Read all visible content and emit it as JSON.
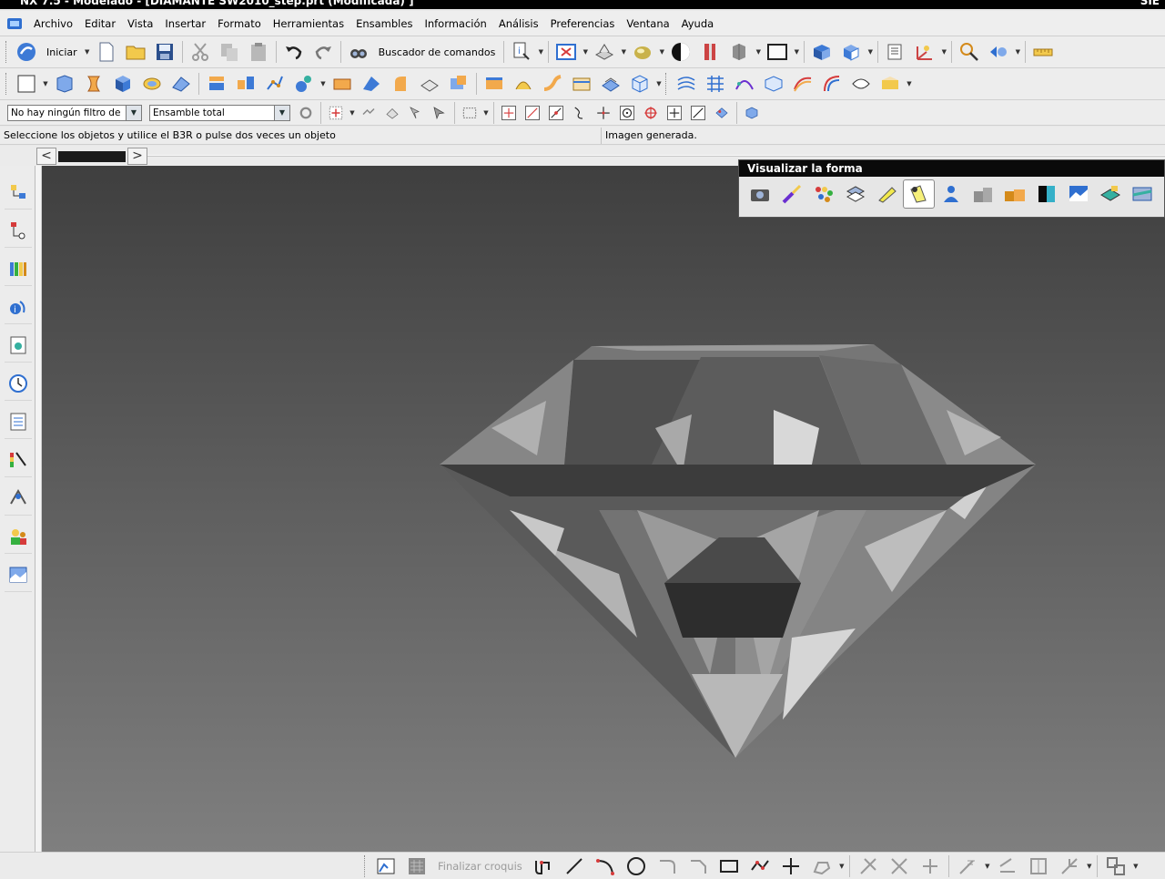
{
  "window": {
    "title": "NX 7.5 - Modelado - [DIAMANTE SW2010_step.prt (Modificada) ]",
    "brand": "SIE"
  },
  "menu": [
    "Archivo",
    "Editar",
    "Vista",
    "Insertar",
    "Formato",
    "Herramientas",
    "Ensambles",
    "Información",
    "Análisis",
    "Preferencias",
    "Ventana",
    "Ayuda"
  ],
  "toolbar1": {
    "start_label": "Iniciar",
    "command_finder_label": "Buscador de comandos"
  },
  "selection_bar": {
    "filter_value": "No hay ningún filtro de",
    "scope_value": "Ensamble total"
  },
  "status": {
    "prompt": "Seleccione los objetos y utilice el B3R o pulse dos veces un objeto",
    "message": "Imagen generada."
  },
  "shape_palette": {
    "title": "Visualizar la forma"
  },
  "sketch_bar": {
    "finish_label": "Finalizar croquis"
  },
  "colors": {
    "accent": "#2f6fd0",
    "viewport_top": "#3f3f3f",
    "viewport_bottom": "#7f7f7f",
    "titlebar": "#000000"
  },
  "icons": {
    "toolbar1": [
      "start-icon",
      "new-file-icon",
      "open-folder-icon",
      "save-icon",
      "cut-icon",
      "copy-icon",
      "paste-icon",
      "undo-icon",
      "redo-icon",
      "command-finder-icon",
      "info-icon",
      "fit-icon",
      "orient-view-icon",
      "shading-icon",
      "render-style-icon",
      "section-icon",
      "box-icon",
      "frame-icon",
      "assembly-icon",
      "component-icon",
      "layers-icon",
      "wcs-icon",
      "analysis-icon",
      "motion-icon",
      "measure-icon"
    ],
    "toolbar2": [
      "sketch-icon",
      "extrude-icon",
      "revolve-icon",
      "block-icon",
      "surface-icon",
      "shell-icon",
      "datum-icon",
      "pattern-icon",
      "point-icon",
      "edge-blend-icon",
      "chamfer-icon",
      "draft-icon",
      "trim-icon",
      "mirror-icon",
      "unite-icon"
    ],
    "resource_bar": [
      "assembly-navigator-icon",
      "constraint-navigator-icon",
      "part-navigator-icon",
      "reuse-library-icon",
      "history-icon",
      "web-browser-icon",
      "clock-icon",
      "roles-icon",
      "analysis-icon",
      "system-materials-icon",
      "user-icon",
      "system-scene-icon"
    ],
    "palette": [
      "camera-icon",
      "paintbrush-icon",
      "molecules-icon",
      "material-icon",
      "highlighter-icon",
      "spotlight-icon",
      "person-icon",
      "stack-icon",
      "boxes-icon",
      "cube-shade-icon",
      "landscape-icon",
      "layer-icon",
      "window-icon"
    ]
  }
}
